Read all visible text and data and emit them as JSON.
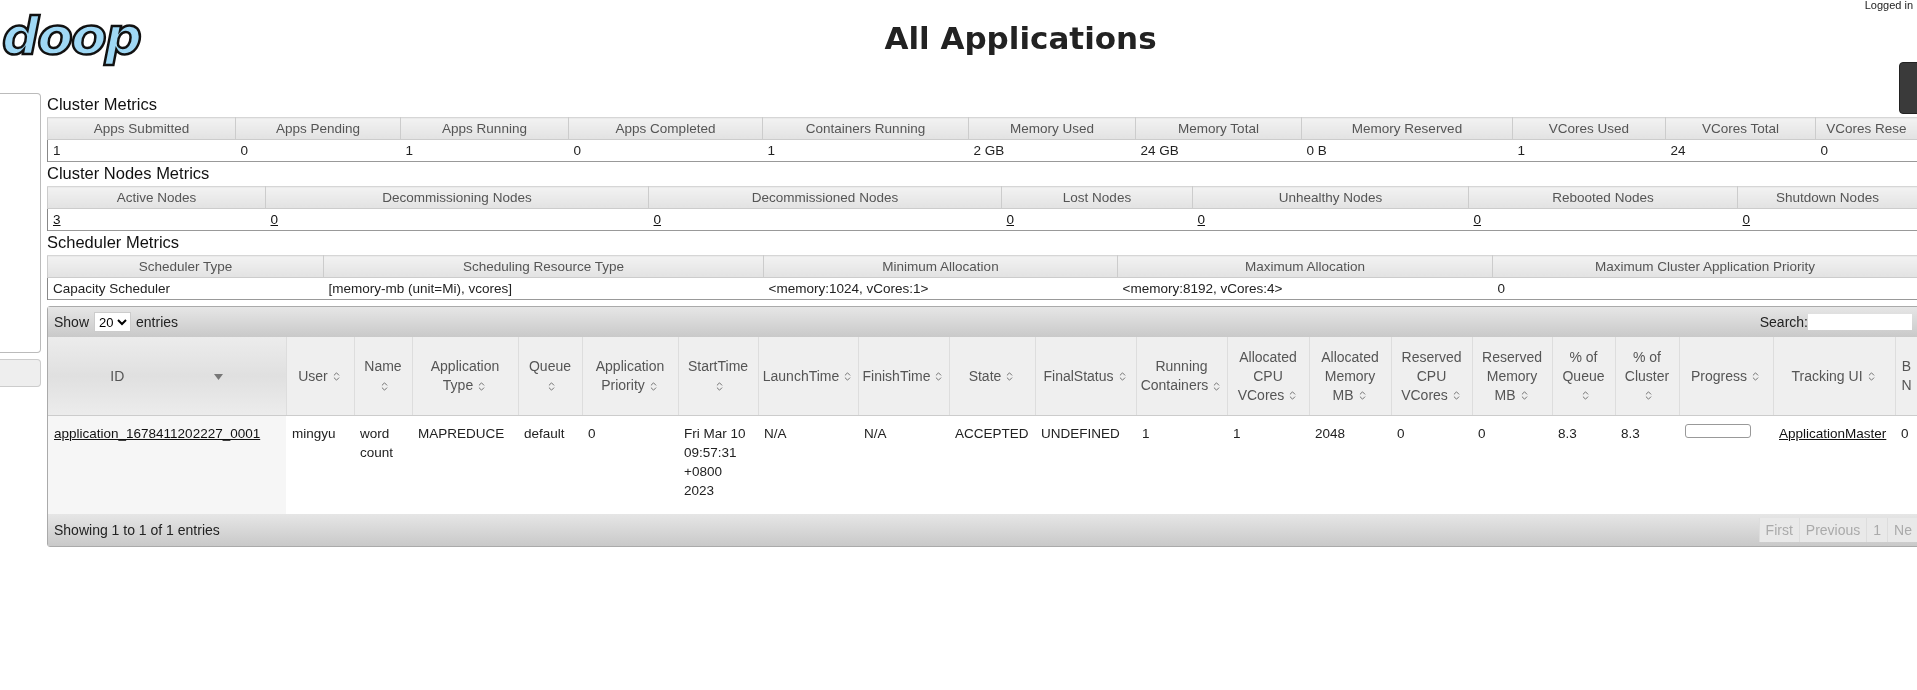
{
  "logo": {
    "text": "doop"
  },
  "title": "All Applications",
  "user_bar": {
    "text": "Logged in"
  },
  "cluster_metrics": {
    "heading": "Cluster Metrics",
    "columns": [
      "Apps Submitted",
      "Apps Pending",
      "Apps Running",
      "Apps Completed",
      "Containers Running",
      "Memory Used",
      "Memory Total",
      "Memory Reserved",
      "VCores Used",
      "VCores Total",
      "VCores Rese"
    ],
    "row": [
      {
        "text": "1",
        "link": false
      },
      {
        "text": "0",
        "link": false
      },
      {
        "text": "1",
        "link": false
      },
      {
        "text": "0",
        "link": false
      },
      {
        "text": "1",
        "link": false
      },
      {
        "text": "2 GB",
        "link": false
      },
      {
        "text": "24 GB",
        "link": false
      },
      {
        "text": "0 B",
        "link": false
      },
      {
        "text": "1",
        "link": false
      },
      {
        "text": "24",
        "link": false
      },
      {
        "text": "0",
        "link": false
      }
    ]
  },
  "cluster_nodes_metrics": {
    "heading": "Cluster Nodes Metrics",
    "columns": [
      "Active Nodes",
      "Decommissioning Nodes",
      "Decommissioned Nodes",
      "Lost Nodes",
      "Unhealthy Nodes",
      "Rebooted Nodes",
      "Shutdown Nodes"
    ],
    "row": [
      {
        "text": "3",
        "link": true
      },
      {
        "text": "0",
        "link": true
      },
      {
        "text": "0",
        "link": true
      },
      {
        "text": "0",
        "link": true
      },
      {
        "text": "0",
        "link": true
      },
      {
        "text": "0",
        "link": true
      },
      {
        "text": "0",
        "link": true
      }
    ]
  },
  "scheduler_metrics": {
    "heading": "Scheduler Metrics",
    "columns": [
      "Scheduler Type",
      "Scheduling Resource Type",
      "Minimum Allocation",
      "Maximum Allocation",
      "Maximum Cluster Application Priority"
    ],
    "row": [
      {
        "text": "Capacity Scheduler",
        "link": false
      },
      {
        "text": "[memory-mb (unit=Mi), vcores]",
        "link": false
      },
      {
        "text": "<memory:1024, vCores:1>",
        "link": false
      },
      {
        "text": "<memory:8192, vCores:4>",
        "link": false
      },
      {
        "text": "0",
        "link": false
      }
    ]
  },
  "applications": {
    "length_menu": {
      "before": "Show",
      "value": "20",
      "after": "entries"
    },
    "search": {
      "label": "Search:"
    },
    "columns": [
      {
        "label": "ID",
        "sorted": true
      },
      {
        "label": "User",
        "sorted": false
      },
      {
        "label": "Name",
        "sorted": false
      },
      {
        "label": "Application Type",
        "sorted": false
      },
      {
        "label": "Queue",
        "sorted": false
      },
      {
        "label": "Application Priority",
        "sorted": false
      },
      {
        "label": "StartTime",
        "sorted": false
      },
      {
        "label": "LaunchTime",
        "sorted": false
      },
      {
        "label": "FinishTime",
        "sorted": false
      },
      {
        "label": "State",
        "sorted": false
      },
      {
        "label": "FinalStatus",
        "sorted": false
      },
      {
        "label": "Running Containers",
        "sorted": false
      },
      {
        "label": "Allocated CPU VCores",
        "sorted": false
      },
      {
        "label": "Allocated Memory MB",
        "sorted": false
      },
      {
        "label": "Reserved CPU VCores",
        "sorted": false
      },
      {
        "label": "Reserved Memory MB",
        "sorted": false
      },
      {
        "label": "% of Queue",
        "sorted": false
      },
      {
        "label": "% of Cluster",
        "sorted": false
      },
      {
        "label": "Progress",
        "sorted": false
      },
      {
        "label": "Tracking UI",
        "sorted": false
      },
      {
        "label": "B N"
      }
    ],
    "rows": [
      {
        "cells": [
          {
            "kind": "link",
            "text": "application_1678411202227_0001"
          },
          {
            "kind": "text",
            "text": "mingyu"
          },
          {
            "kind": "text",
            "text": "word count"
          },
          {
            "kind": "text",
            "text": "MAPREDUCE"
          },
          {
            "kind": "text",
            "text": "default"
          },
          {
            "kind": "text",
            "text": "0"
          },
          {
            "kind": "text",
            "text": "Fri Mar 10 09:57:31 +0800 2023"
          },
          {
            "kind": "text",
            "text": "N/A"
          },
          {
            "kind": "text",
            "text": "N/A"
          },
          {
            "kind": "text",
            "text": "ACCEPTED"
          },
          {
            "kind": "text",
            "text": "UNDEFINED"
          },
          {
            "kind": "text",
            "text": "1"
          },
          {
            "kind": "text",
            "text": "1"
          },
          {
            "kind": "text",
            "text": "2048"
          },
          {
            "kind": "text",
            "text": "0"
          },
          {
            "kind": "text",
            "text": "0"
          },
          {
            "kind": "text",
            "text": "8.3"
          },
          {
            "kind": "text",
            "text": "8.3"
          },
          {
            "kind": "progress",
            "level": 0
          },
          {
            "kind": "link",
            "text": "ApplicationMaster"
          },
          {
            "kind": "text",
            "text": "0"
          }
        ]
      }
    ],
    "info": "Showing 1 to 1 of 1 entries",
    "pagination": [
      {
        "label": "First",
        "disabled": true
      },
      {
        "label": "Previous",
        "disabled": true
      },
      {
        "label": "1",
        "disabled": true
      },
      {
        "label": "Ne",
        "disabled": true
      }
    ]
  }
}
